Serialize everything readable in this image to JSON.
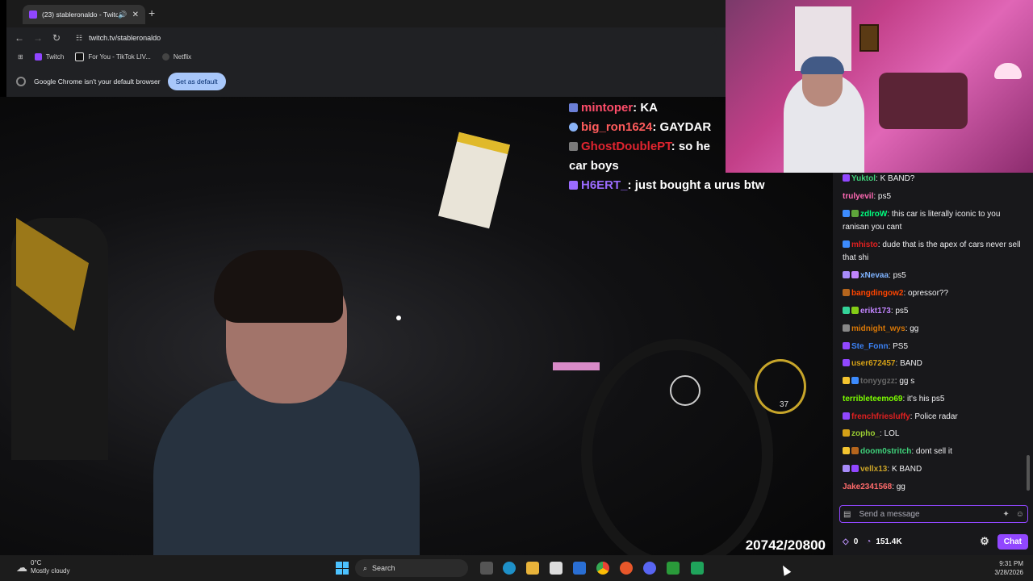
{
  "browser": {
    "tab_title": "(23) stableronaldo - Twitch",
    "url": "twitch.tv/stableronaldo",
    "bookmarks": [
      {
        "label": "Twitch",
        "icon": "twitch-icon",
        "color": "#9146ff"
      },
      {
        "label": "For You - TikTok LIV...",
        "icon": "tiktok-icon",
        "color": "#222222"
      },
      {
        "label": "Netflix",
        "icon": "netflix-icon",
        "color": "#e50914"
      }
    ],
    "infobar_text": "Google Chrome isn't your default browser",
    "infobar_button": "Set as default"
  },
  "stream": {
    "overlay_chat": [
      {
        "user": "mintoper",
        "color": "#ff4d6a",
        "text": "KA"
      },
      {
        "user": "big_ron1624",
        "color": "#ff5c5c",
        "text": "GAYDAR"
      },
      {
        "user": "GhostDoublePT",
        "color": "#e0242f",
        "text": "so he"
      },
      {
        "user": "",
        "color": "#ffffff",
        "text": "car boys"
      },
      {
        "user": "H6ERT_",
        "color": "#9b6bff",
        "text": "just bought a urus btw"
      }
    ],
    "counter": "20742/20800",
    "gauge_value": "37"
  },
  "chat": {
    "messages": [
      {
        "user": "Yuktol",
        "color": "#3fd17a",
        "text": "K BAND?",
        "badges": [
          "#9147ff"
        ]
      },
      {
        "user": "trulyevil",
        "color": "#ff69b4",
        "text": "ps5",
        "badges": []
      },
      {
        "user": "zdlroW",
        "color": "#00ff7f",
        "text": "this car is literally iconic to you ranisan you cant",
        "badges": [
          "#3d8bfd",
          "#5ea33a"
        ]
      },
      {
        "user": "mhisto",
        "color": "#e02020",
        "text": "dude that is the apex of cars never sell that shi",
        "badges": [
          "#3d8bfd"
        ]
      },
      {
        "user": "xNevaa",
        "color": "#7fb3ff",
        "text": "ps5",
        "badges": [
          "#a78bfa",
          "#c084fc"
        ]
      },
      {
        "user": "bangdingow2",
        "color": "#ff4500",
        "text": "opressor??",
        "badges": [
          "#b5651d"
        ]
      },
      {
        "user": "erikt173",
        "color": "#c084fc",
        "text": "ps5",
        "badges": [
          "#34d399",
          "#84cc16"
        ]
      },
      {
        "user": "midnight_wys",
        "color": "#d97706",
        "text": "gg",
        "badges": [
          "#888888"
        ]
      },
      {
        "user": "Ste_Fonn",
        "color": "#3b82f6",
        "text": "PS5",
        "badges": [
          "#9147ff"
        ]
      },
      {
        "user": "user672457",
        "color": "#d4a017",
        "text": "BAND",
        "badges": [
          "#9147ff"
        ]
      },
      {
        "user": "tonyygzz",
        "color": "#666666",
        "text": "gg s",
        "badges": [
          "#f4c430",
          "#3d8bfd"
        ]
      },
      {
        "user": "terribleteemo69",
        "color": "#7cfc00",
        "text": "it's his ps5",
        "badges": []
      },
      {
        "user": "frenchfriesluffy",
        "color": "#e02020",
        "text": "Police radar",
        "badges": [
          "#9147ff"
        ]
      },
      {
        "user": "zopho_",
        "color": "#9acd32",
        "text": "LOL",
        "badges": [
          "#d4a017"
        ]
      },
      {
        "user": "doom0stritch",
        "color": "#3fd17a",
        "text": "dont sell it",
        "badges": [
          "#f4c430",
          "#b5651d"
        ]
      },
      {
        "user": "vellx13",
        "color": "#c9a227",
        "text": "K BAND",
        "badges": [
          "#a78bfa",
          "#9147ff"
        ]
      },
      {
        "user": "Jake2341568",
        "color": "#ff6b6b",
        "text": "gg",
        "badges": []
      }
    ],
    "input_placeholder": "Send a message",
    "bits": "0",
    "points": "151.4K",
    "chat_button": "Chat"
  },
  "taskbar": {
    "weather_temp": "0°C",
    "weather_desc": "Mostly cloudy",
    "search_label": "Search",
    "time": "9:31 PM",
    "date": "3/28/2026"
  }
}
